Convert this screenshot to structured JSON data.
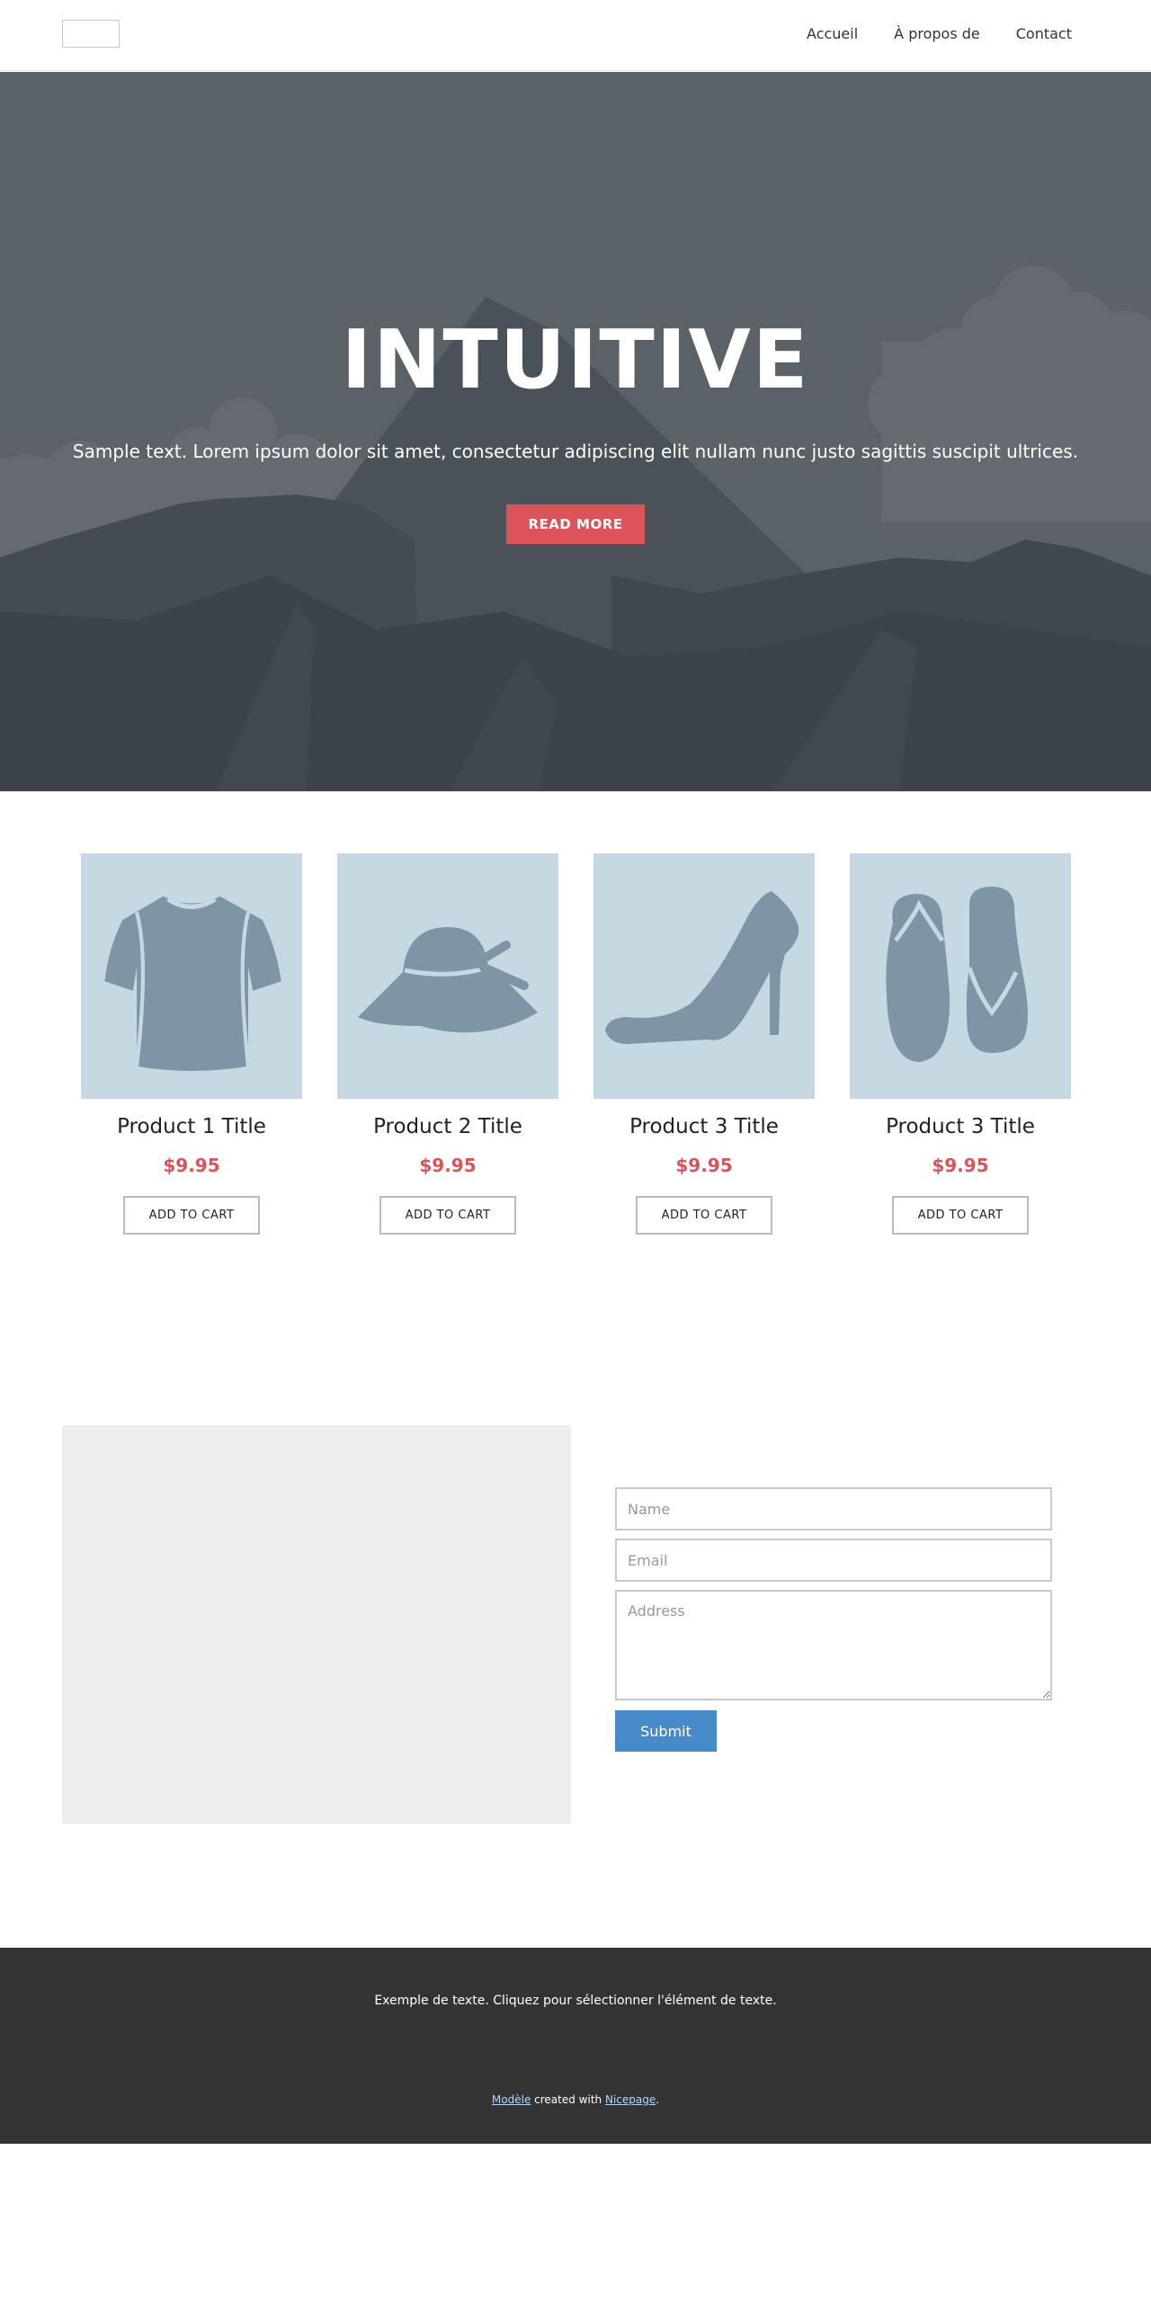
{
  "header": {
    "nav": [
      "Accueil",
      "À propos de",
      "Contact"
    ]
  },
  "hero": {
    "title": "INTUITIVE",
    "text": "Sample text. Lorem ipsum dolor sit amet, consectetur adipiscing elit nullam nunc justo sagittis suscipit ultrices.",
    "button": "READ MORE"
  },
  "products": [
    {
      "title": "Product 1 Title",
      "price": "$9.95",
      "cart": "ADD TO CART",
      "icon": "tshirt-icon"
    },
    {
      "title": "Product 2 Title",
      "price": "$9.95",
      "cart": "ADD TO CART",
      "icon": "hat-icon"
    },
    {
      "title": "Product 3 Title",
      "price": "$9.95",
      "cart": "ADD TO CART",
      "icon": "high-heel-icon"
    },
    {
      "title": "Product 3 Title",
      "price": "$9.95",
      "cart": "ADD TO CART",
      "icon": "flip-flops-icon"
    }
  ],
  "form": {
    "name_placeholder": "Name",
    "email_placeholder": "Email",
    "address_placeholder": "Address",
    "submit": "Submit"
  },
  "footer": {
    "text": "Exemple de texte. Cliquez pour sélectionner l'élément de texte.",
    "credit_link1": "Modèle",
    "credit_middle": " created with ",
    "credit_link2": "Nicepage",
    "credit_end": "."
  },
  "colors": {
    "accent": "#db545a",
    "button_blue": "#478ac9",
    "product_bg": "#c6d8e2",
    "footer_bg": "#333333"
  }
}
